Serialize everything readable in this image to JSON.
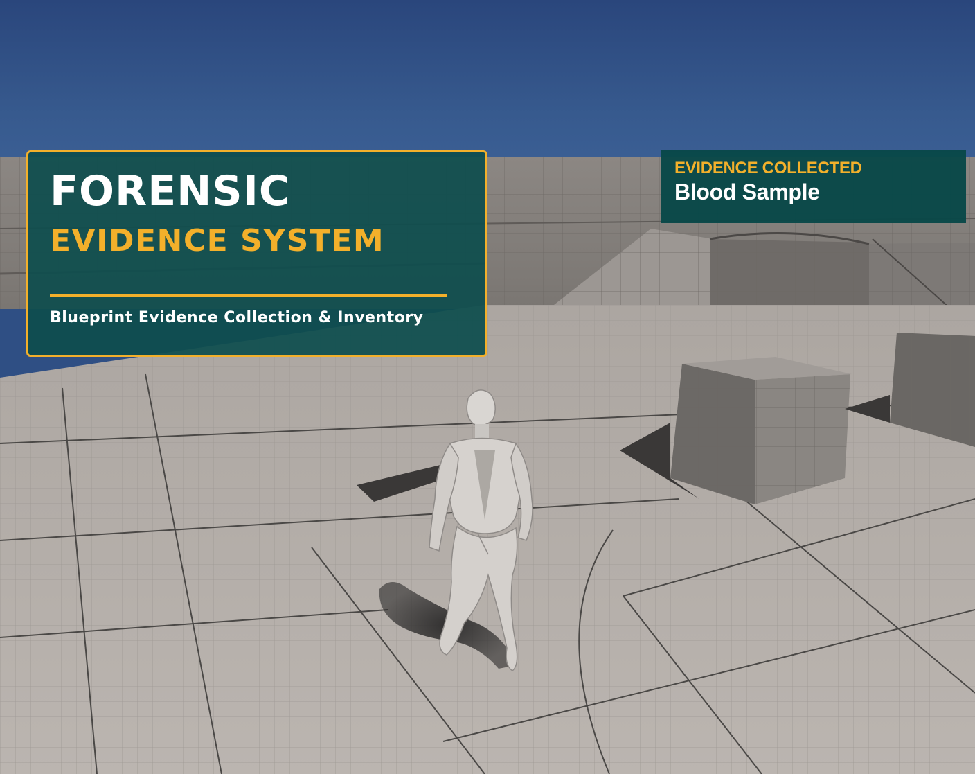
{
  "title_card": {
    "title": "FORENSIC",
    "subtitle": "EVIDENCE SYSTEM",
    "caption": "Blueprint Evidence Collection & Inventory"
  },
  "notification": {
    "heading": "EVIDENCE COLLECTED",
    "item": "Blood Sample"
  },
  "colors": {
    "accent": "#f3b02b",
    "panel": "#0e4e4e",
    "sky": "#2f4f84",
    "floor": "#b4aea9"
  },
  "scene": {
    "character": "mannequin-character",
    "environment": "grid-test-level"
  }
}
